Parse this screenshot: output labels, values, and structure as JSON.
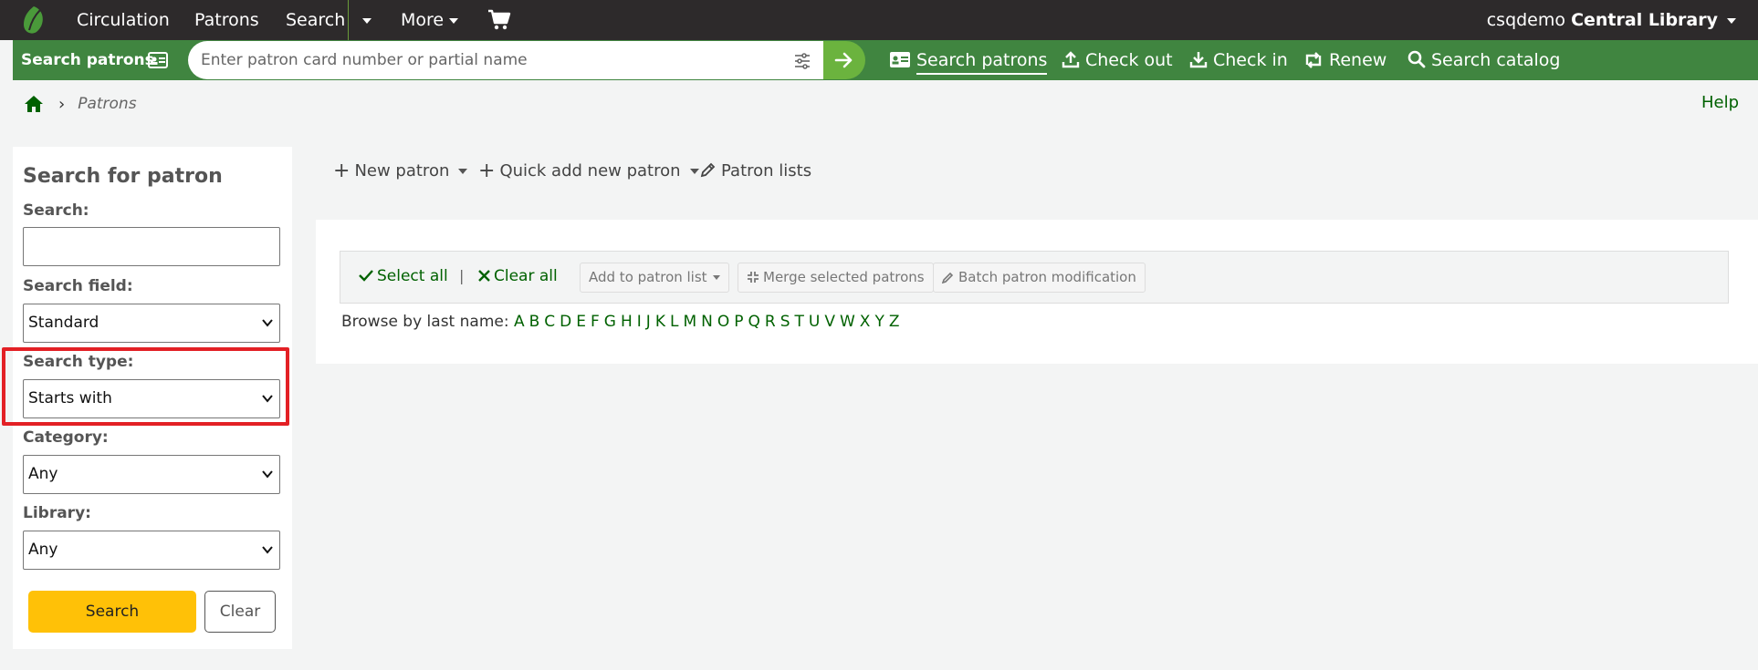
{
  "topnav": {
    "links": [
      "Circulation",
      "Patrons",
      "Search",
      "More"
    ],
    "user": "csqdemo",
    "library": "Central Library"
  },
  "searchbar": {
    "label": "Search patrons",
    "placeholder": "Enter patron card number or partial name",
    "links": [
      "Search patrons",
      "Check out",
      "Check in",
      "Renew",
      "Search catalog"
    ]
  },
  "breadcrumb": {
    "current": "Patrons",
    "help": "Help"
  },
  "sidebar": {
    "title": "Search for patron",
    "search_label": "Search:",
    "search_value": "",
    "field_label": "Search field:",
    "field_value": "Standard",
    "type_label": "Search type:",
    "type_value": "Starts with",
    "category_label": "Category:",
    "category_value": "Any",
    "library_label": "Library:",
    "library_value": "Any",
    "search_button": "Search",
    "clear_button": "Clear"
  },
  "toolbar": {
    "new_patron": "New patron",
    "quick_add": "Quick add new patron",
    "patron_lists": "Patron lists"
  },
  "actions": {
    "select_all": "Select all",
    "clear_all": "Clear all",
    "add_to_list": "Add to patron list",
    "merge": "Merge selected patrons",
    "batch_mod": "Batch patron modification"
  },
  "browse": {
    "label": "Browse by last name:",
    "letters": [
      "A",
      "B",
      "C",
      "D",
      "E",
      "F",
      "G",
      "H",
      "I",
      "J",
      "K",
      "L",
      "M",
      "N",
      "O",
      "P",
      "Q",
      "R",
      "S",
      "T",
      "U",
      "V",
      "W",
      "X",
      "Y",
      "Z"
    ]
  },
  "colors": {
    "topnav_bg": "#2d2a2b",
    "searchbar_bg": "#408540",
    "link_green": "#006100",
    "search_btn": "#ffc107",
    "highlight": "#e32025"
  }
}
